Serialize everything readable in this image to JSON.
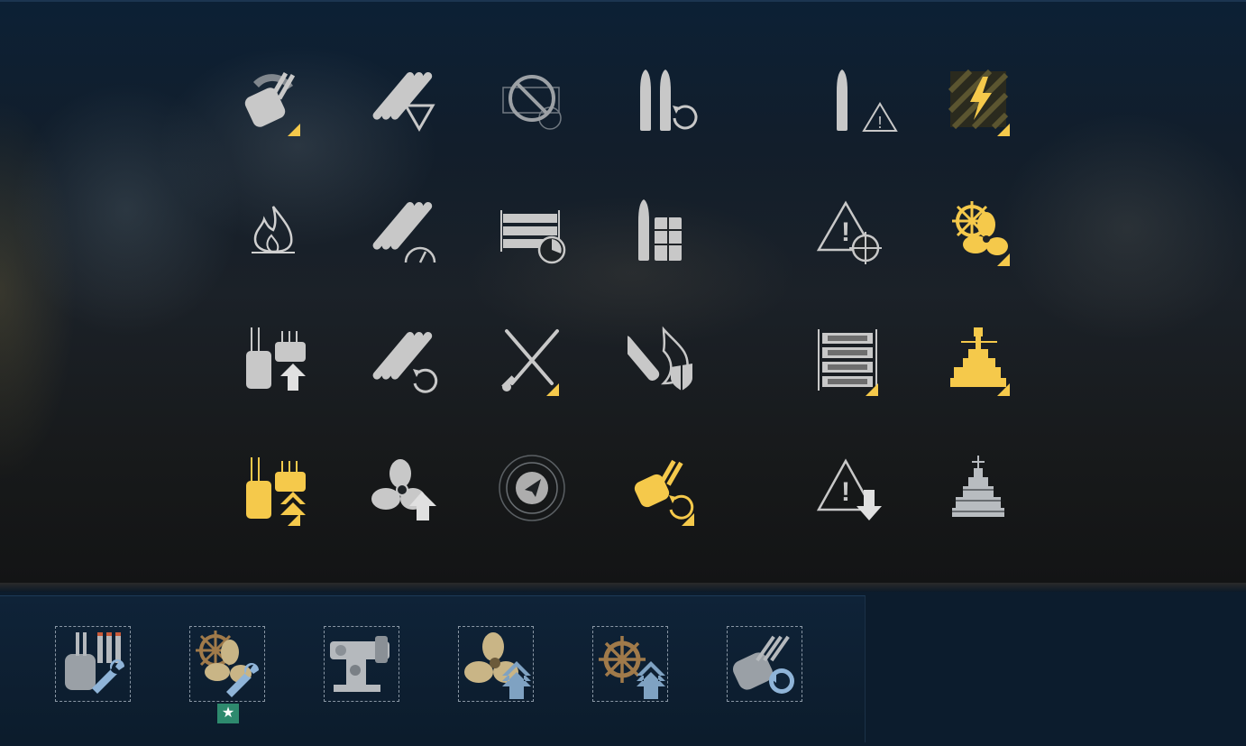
{
  "colors": {
    "icon_gray": "#c8c8c8",
    "icon_gold": "#f5c94b",
    "accent_triangle": "#f5c94b",
    "slot_border": "#8a97a5",
    "special_badge": "#2e8a6e",
    "panel_bg": "#0c1c2d"
  },
  "grid_icons": [
    {
      "icon": "turret-traverse-icon",
      "state": "gray",
      "modified": true
    },
    {
      "icon": "torpedo-detection-icon",
      "state": "gray",
      "modified": false
    },
    {
      "icon": "disabled-launcher-icon",
      "state": "dim",
      "modified": false
    },
    {
      "icon": "shell-reload-icon",
      "state": "gray",
      "modified": false
    },
    {
      "icon": "shell-warning-icon",
      "state": "gray",
      "modified": false
    },
    {
      "icon": "electric-hazard-icon",
      "state": "gold",
      "modified": true
    },
    {
      "icon": "fire-icon",
      "state": "gray",
      "modified": false
    },
    {
      "icon": "torpedo-speed-icon",
      "state": "gray",
      "modified": false
    },
    {
      "icon": "launcher-timer-icon",
      "state": "gray",
      "modified": false
    },
    {
      "icon": "shell-ammo-icon",
      "state": "gray",
      "modified": false
    },
    {
      "icon": "warning-crosshair-icon",
      "state": "gray",
      "modified": false
    },
    {
      "icon": "steering-propeller-icon",
      "state": "gold",
      "modified": true
    },
    {
      "icon": "secondary-upgrade-icon",
      "state": "gray",
      "modified": false
    },
    {
      "icon": "torpedo-reload-icon",
      "state": "gray",
      "modified": false
    },
    {
      "icon": "crossed-swords-icon",
      "state": "gray",
      "modified": true
    },
    {
      "icon": "fire-shield-icon",
      "state": "gray",
      "modified": false
    },
    {
      "icon": "launcher-stack-icon",
      "state": "gray",
      "modified": true
    },
    {
      "icon": "ship-superstructure-icon",
      "state": "gold",
      "modified": true
    },
    {
      "icon": "secondary-double-upgrade-icon",
      "state": "gold",
      "modified": true
    },
    {
      "icon": "propeller-upgrade-icon",
      "state": "gray",
      "modified": false
    },
    {
      "icon": "radar-compass-icon",
      "state": "dim",
      "modified": false
    },
    {
      "icon": "turret-rotate-icon",
      "state": "gold",
      "modified": true
    },
    {
      "icon": "warning-down-icon",
      "state": "gray",
      "modified": false
    },
    {
      "icon": "ship-silhouette-icon",
      "state": "gray",
      "modified": false
    }
  ],
  "upgrade_slots": [
    {
      "icon": "turret-repair-upgrade-icon",
      "special": false
    },
    {
      "icon": "steering-repair-upgrade-icon",
      "special": true,
      "badge": "★"
    },
    {
      "icon": "rangefinder-upgrade-icon",
      "special": false
    },
    {
      "icon": "propulsion-upgrade-icon",
      "special": false
    },
    {
      "icon": "steering-gear-upgrade-icon",
      "special": false
    },
    {
      "icon": "turret-reload-upgrade-icon",
      "special": false
    }
  ]
}
